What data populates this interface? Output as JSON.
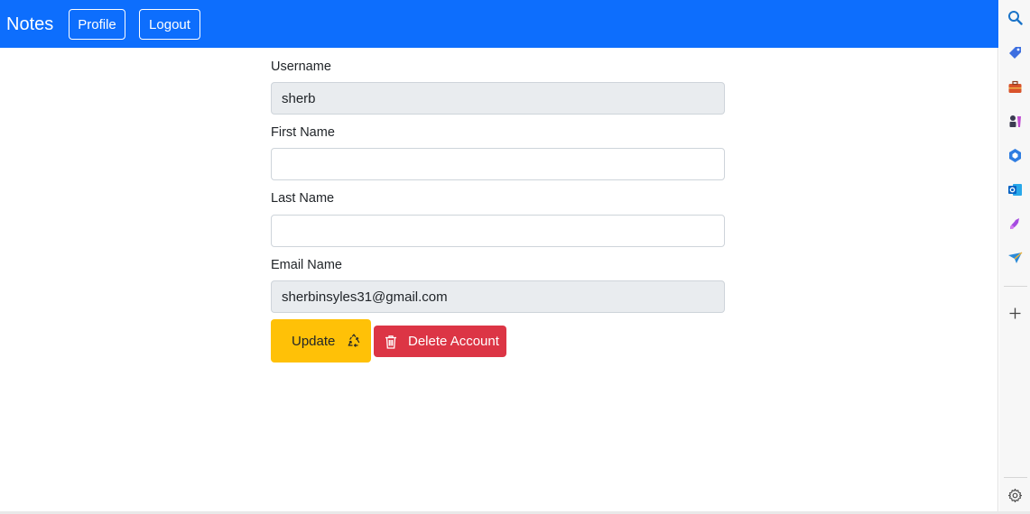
{
  "navbar": {
    "brand": "Notes",
    "profile_label": "Profile",
    "logout_label": "Logout",
    "bg_color": "#0d6efd"
  },
  "form": {
    "username_label": "Username",
    "username_value": "sherb",
    "first_name_label": "First Name",
    "first_name_value": "",
    "last_name_label": "Last Name",
    "last_name_value": "",
    "email_label": "Email Name",
    "email_value": "sherbinsyles31@gmail.com"
  },
  "actions": {
    "update_label": "Update",
    "update_icon": "recycle-icon",
    "update_color": "#ffc107",
    "delete_label": "Delete Account",
    "delete_icon": "trash-icon",
    "delete_color": "#dc3545"
  },
  "sidebar": {
    "icons": [
      "search-icon",
      "tag-icon",
      "briefcase-icon",
      "chess-icon",
      "copilot-icon",
      "outlook-icon",
      "designer-icon",
      "send-icon",
      "add-icon",
      "settings-icon"
    ]
  }
}
